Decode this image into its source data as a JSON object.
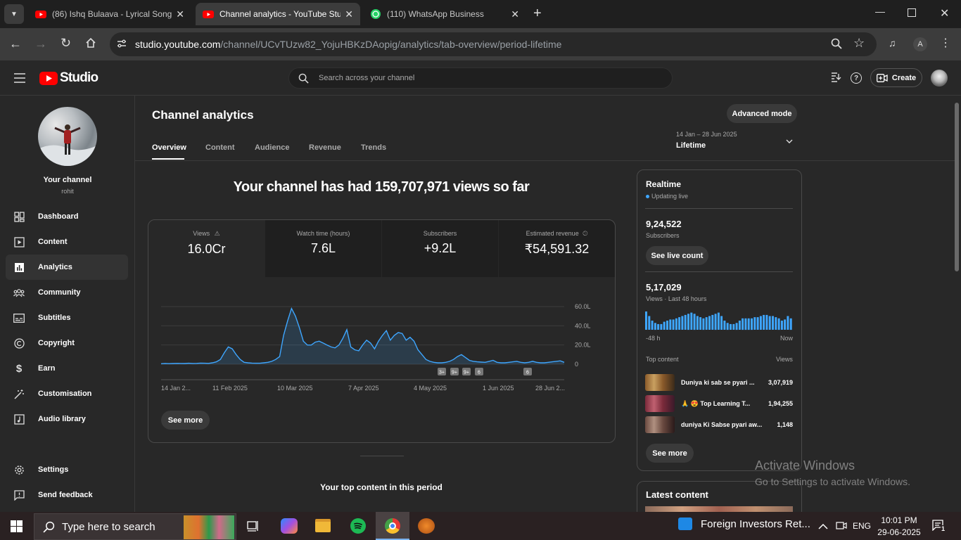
{
  "browser": {
    "tabs": [
      {
        "title": "(86) Ishq Bulaava - Lyrical Song",
        "active": false
      },
      {
        "title": "Channel analytics - YouTube Stu",
        "active": true
      },
      {
        "title": "(110) WhatsApp Business",
        "active": false
      }
    ],
    "url_host": "studio.youtube.com",
    "url_path": "/channel/UCvTUzw82_YojuHBKzDAopig/analytics/tab-overview/period-lifetime",
    "profile_letter": "A"
  },
  "header": {
    "logo_text": "Studio",
    "search_placeholder": "Search across your channel",
    "create_label": "Create"
  },
  "sidebar": {
    "channel_label": "Your channel",
    "channel_name": "rohit",
    "items": [
      {
        "label": "Dashboard",
        "icon": "dashboard-icon"
      },
      {
        "label": "Content",
        "icon": "content-icon"
      },
      {
        "label": "Analytics",
        "icon": "analytics-icon",
        "selected": true
      },
      {
        "label": "Community",
        "icon": "community-icon"
      },
      {
        "label": "Subtitles",
        "icon": "subtitles-icon"
      },
      {
        "label": "Copyright",
        "icon": "copyright-icon"
      },
      {
        "label": "Earn",
        "icon": "earn-icon"
      },
      {
        "label": "Customisation",
        "icon": "customisation-icon"
      },
      {
        "label": "Audio library",
        "icon": "audio-library-icon"
      }
    ],
    "settings_label": "Settings",
    "feedback_label": "Send feedback"
  },
  "main": {
    "title": "Channel analytics",
    "advanced_mode": "Advanced mode",
    "tabs": [
      "Overview",
      "Content",
      "Audience",
      "Revenue",
      "Trends"
    ],
    "date_range": "14 Jan – 28 Jun 2025",
    "period": "Lifetime",
    "headline": "Your channel has had 159,707,971 views so far",
    "metrics": [
      {
        "label": "Views",
        "value": "16.0Cr"
      },
      {
        "label": "Watch time (hours)",
        "value": "7.6L"
      },
      {
        "label": "Subscribers",
        "value": "+9.2L"
      },
      {
        "label": "Estimated revenue",
        "value": "₹54,591.32"
      }
    ],
    "see_more": "See more",
    "top_content_heading": "Your top content in this period"
  },
  "chart_data": {
    "type": "area",
    "x_ticks": [
      "14 Jan 2...",
      "11 Feb 2025",
      "10 Mar 2025",
      "7 Apr 2025",
      "4 May 2025",
      "1 Jun 2025",
      "28 Jun 2..."
    ],
    "y_ticks": [
      "60.0L",
      "40.0L",
      "20.0L",
      "0"
    ],
    "ylim": [
      0,
      60
    ],
    "y_unit": "L",
    "series": [
      {
        "values": [
          0.5,
          0.8,
          0.6,
          0.7,
          0.9,
          0.8,
          0.7,
          1.0,
          0.8,
          0.9,
          1.2,
          1.0,
          0.9,
          1.5,
          2.5,
          5,
          12,
          18,
          16,
          10,
          5,
          2,
          1.5,
          1.2,
          1.0,
          1.0,
          1.5,
          2,
          3,
          5,
          8,
          30,
          45,
          58,
          50,
          38,
          24,
          20,
          20,
          23,
          24,
          22,
          20,
          18,
          17,
          20,
          27,
          36,
          18,
          15,
          14,
          20,
          25,
          22,
          16,
          24,
          30,
          35,
          25,
          30,
          33,
          32,
          25,
          28,
          24,
          15,
          10,
          5,
          3,
          2,
          1.5,
          1.5,
          2,
          3,
          5,
          8,
          10,
          7,
          4,
          3,
          2.5,
          2.2,
          2,
          3,
          4,
          2,
          1.5,
          1.5,
          2,
          2.5,
          3,
          2,
          1.5,
          2,
          3,
          2,
          1.5,
          1.5,
          2,
          2.5,
          3,
          3.5,
          2
        ]
      }
    ],
    "annotations": [
      "3+",
      "9+",
      "9+",
      "6",
      "6"
    ],
    "grid": true
  },
  "realtime": {
    "title": "Realtime",
    "status": "Updating live",
    "subscribers_value": "9,24,522",
    "subscribers_label": "Subscribers",
    "see_live_count": "See live count",
    "views_value": "5,17,029",
    "views_label": "Views · Last 48 hours",
    "axis_start": "-48 h",
    "axis_end": "Now",
    "bars": [
      8,
      6,
      4,
      3,
      2.5,
      2.5,
      3.5,
      4,
      4.5,
      4.5,
      5,
      5.5,
      6,
      6.5,
      7,
      7.5,
      7,
      6,
      5.5,
      5,
      5.5,
      6,
      6.5,
      7,
      7.5,
      6,
      4,
      3,
      2.5,
      2.5,
      3,
      4,
      5,
      5,
      5,
      5,
      5.5,
      5.5,
      6,
      6.5,
      6.5,
      6,
      6,
      5.5,
      5,
      4,
      4.5,
      6,
      5
    ],
    "top_content_label": "Top content",
    "views_col_label": "Views",
    "top_content": [
      {
        "title": "Duniya ki sab se pyari ...",
        "views": "3,07,919",
        "thumb": "#8a5a2a"
      },
      {
        "title": "🙏 😍 Top Learning T...",
        "views": "1,94,255",
        "thumb": "#7a2a3a"
      },
      {
        "title": "duniya Ki Sabse pyari aw...",
        "views": "1,148",
        "thumb": "#6a4a40"
      }
    ],
    "see_more": "See more"
  },
  "latest": {
    "title": "Latest content"
  },
  "watermark": {
    "line1": "Activate Windows",
    "line2": "Go to Settings to activate Windows."
  },
  "taskbar": {
    "search_placeholder": "Type here to search",
    "news_text": "Foreign Investors Ret...",
    "lang": "ENG",
    "time": "10:01 PM",
    "date": "29-06-2025",
    "notification_count": "1"
  },
  "colors": {
    "accent": "#3ea6ff",
    "youtube_red": "#ff0000",
    "bg": "#282828"
  }
}
